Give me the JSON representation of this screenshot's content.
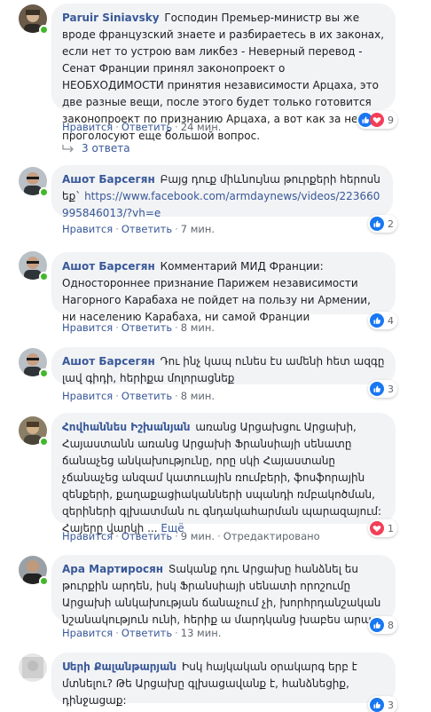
{
  "comments": [
    {
      "author": "Paruir Siniavsky",
      "text": "Господин Премьер-министр вы же вроде французский знаете и разбираетесь в их законах, если нет то устрою вам ликбез - Неверный перевод - Сенат Франции принял законопроект о НЕОБХОДИМОСТИ принятия независимости Арцаха, это две разные вещи, после этого будет только готовится законопроект по признанию Арцаха, а вот как за него проголосуют еще большой вопрос.",
      "like_label": "Нравится",
      "reply_label": "Ответить",
      "time": "24 мин.",
      "reactions": [
        "like-reaction",
        "love-reaction"
      ],
      "reaction_count": "9",
      "replies_label": "3 ответа"
    },
    {
      "author": "Ашот Барсегян",
      "text": "Բայց դուք միևնույնա թուրքերի հերոսն եք`",
      "link": "https://www.facebook.com/armdaynews/videos/223660995846013/?vh=e",
      "like_label": "Нравится",
      "reply_label": "Ответить",
      "time": "7 мин.",
      "reaction_count": "2"
    },
    {
      "author": "Ашот Барсегян",
      "text": "Комментарий МИД Франции: Одностороннее признание Парижем независимости Нагорного Карабаха не пойдет на пользу ни Армении, ни населению Карабаха, ни самой Франции",
      "like_label": "Нравится",
      "reply_label": "Ответить",
      "time": "8 мин.",
      "reaction_count": "4"
    },
    {
      "author": "Ашот Барсегян",
      "text": "Դու ինչ կապ ունես էս ամենի հետ ազգը լավ գիդի, հերիքա մոլորացնեք",
      "like_label": "Нравится",
      "reply_label": "Ответить",
      "time": "8 мин.",
      "reaction_count": "3"
    },
    {
      "author": "Հովհաննես Իշխանյան",
      "text": "առանց Արցախցու Արցախի, Հայաստանն առանց Արցախի Ֆրանսիայի սենատը ճանաչեց անկախությունը, որը սկի Հայաստանը չճանաչեց անզամ կատուային ռումբերի, ֆոսֆորային զենքերի, քաղաքացիականների սպանդի ռմբակոծման, զերիների գլխատման ու գնդակահարման պարազայում: Հայերը վարկի ...",
      "more_label": "Ещё",
      "like_label": "Нравится",
      "reply_label": "Ответить",
      "time": "9 мин.",
      "edited_label": "Отредактировано",
      "reaction_count": "1"
    },
    {
      "author": "Ара Мартиросян",
      "text": "Տականք դու Արցախը հանձնել ես թուրքին արդեն, իսկ Ֆրանսիայի սենատի որոշումը Արցախի անկախության ճանաչում չի, խորհրդանշական նշանակություն ունի, հերիք ա մարդկանց խաբես արա",
      "like_label": "Нравится",
      "reply_label": "Ответить",
      "time": "13 мин.",
      "reaction_count": "8"
    },
    {
      "author": "Սերի Քալանթարյան",
      "text": "Իսկ հայկական օրակարգ երբ է մտնելու? Թե Արցախը գլխացավանք է, հանձնեցիք, դինջացաք:",
      "reaction_count": "3"
    }
  ],
  "colors": {
    "bubble": "#f2f3f5",
    "author": "#385898",
    "meta": "#606770",
    "online": "#42b72a",
    "like": "#1877f2",
    "love": "#f33e58"
  }
}
